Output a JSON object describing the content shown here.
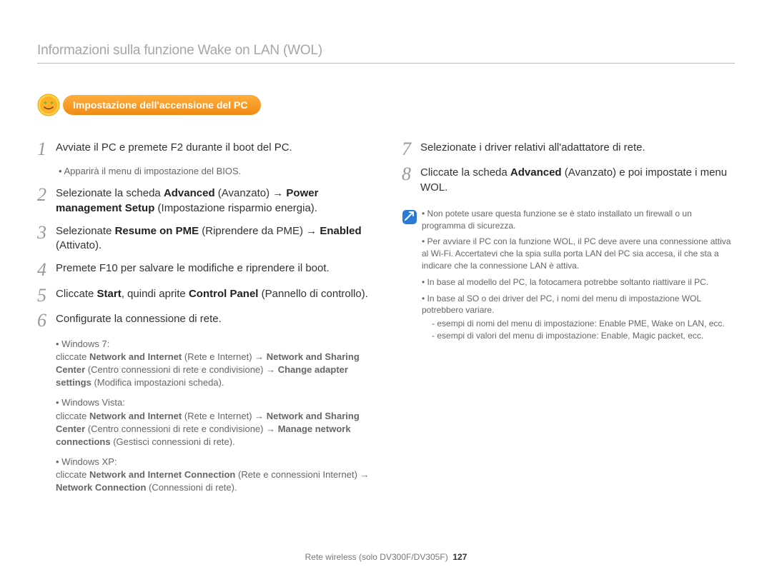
{
  "header": "Informazioni sulla funzione Wake on LAN (WOL)",
  "pill": "Impostazione dell'accensione del PC",
  "left": {
    "s1": {
      "num": "1",
      "text": "Avviate il PC e premete F2 durante il boot del PC.",
      "sub": "Apparirà il menu di impostazione del BIOS."
    },
    "s2": {
      "num": "2",
      "pre": "Selezionate la scheda ",
      "b1": "Advanced",
      "t1": " (Avanzato) → ",
      "b2": "Power management Setup",
      "t2": " (Impostazione risparmio energia)."
    },
    "s3": {
      "num": "3",
      "pre": "Selezionate ",
      "b1": "Resume on PME",
      "t1": " (Riprendere da PME) → ",
      "b2": "Enabled",
      "t2": " (Attivato)."
    },
    "s4": {
      "num": "4",
      "text": "Premete F10 per salvare le modifiche e riprendere il boot."
    },
    "s5": {
      "num": "5",
      "pre": "Cliccate ",
      "b1": "Start",
      "t1": ", quindi aprite ",
      "b2": "Control Panel",
      "t2": " (Pannello di controllo)."
    },
    "s6": {
      "num": "6",
      "text": "Configurate la connessione di rete.",
      "w7_title": "Windows 7:",
      "w7_a": "cliccate ",
      "w7_b1": "Network and Internet",
      "w7_c": " (Rete e Internet) → ",
      "w7_b2": "Network and Sharing Center",
      "w7_d": " (Centro connessioni di rete e condivisione) → ",
      "w7_b3": "Change adapter settings",
      "w7_e": " (Modifica impostazioni scheda).",
      "wv_title": "Windows Vista:",
      "wv_a": "cliccate ",
      "wv_b1": "Network and Internet",
      "wv_c": " (Rete e Internet) → ",
      "wv_b2": "Network and Sharing Center",
      "wv_d": " (Centro connessioni di rete e condivisione) → ",
      "wv_b3": "Manage network connections",
      "wv_e": " (Gestisci connessioni di rete).",
      "wx_title": "Windows XP:",
      "wx_a": "cliccate ",
      "wx_b1": "Network and Internet Connection",
      "wx_c": " (Rete e connessioni Internet) → ",
      "wx_b2": "Network Connection",
      "wx_d": " (Connessioni di rete)."
    }
  },
  "right": {
    "s7": {
      "num": "7",
      "text": "Selezionate i driver relativi all'adattatore di rete."
    },
    "s8": {
      "num": "8",
      "pre": "Cliccate la scheda ",
      "b1": "Advanced",
      "t1": " (Avanzato) e poi impostate i menu WOL."
    },
    "notes": {
      "n1": "Non potete usare questa funzione se è stato installato un firewall o un programma di sicurezza.",
      "n2": "Per avviare il PC con la funzione WOL, il PC deve avere una connessione attiva al Wi-Fi. Accertatevi che la spia sulla porta LAN del PC sia accesa, il che sta a indicare che la connessione LAN è attiva.",
      "n3": "In base al modello del PC, la fotocamera potrebbe soltanto riattivare il PC.",
      "n4": "In base al SO o dei driver del PC, i nomi del menu di impostazione WOL potrebbero variare.",
      "n4a": "esempi di nomi del menu di impostazione: Enable PME, Wake on LAN, ecc.",
      "n4b": "esempi di valori del menu di impostazione: Enable, Magic packet, ecc."
    }
  },
  "footer": {
    "section": "Rete wireless (solo DV300F/DV305F)",
    "page": "127"
  }
}
